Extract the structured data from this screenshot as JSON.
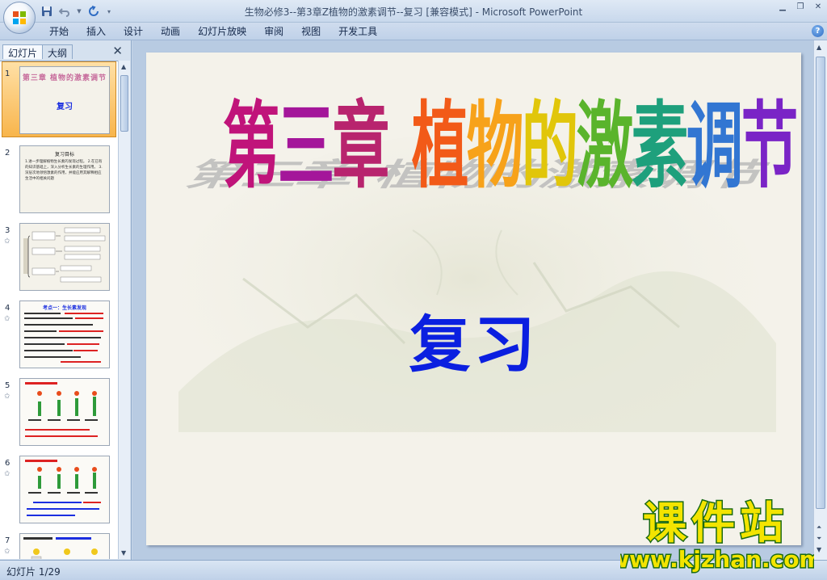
{
  "app": {
    "window_title": "生物必修3--第3章Z植物的激素调节--复习 [兼容模式] - Microsoft PowerPoint"
  },
  "ribbon": {
    "tabs": [
      "开始",
      "插入",
      "设计",
      "动画",
      "幻灯片放映",
      "审阅",
      "视图",
      "开发工具"
    ]
  },
  "pane": {
    "tab_slides": "幻灯片",
    "tab_outline": "大纲",
    "thumbnails": [
      {
        "num": "1",
        "anim": "",
        "title": "第三章 植物的激素调节",
        "body": "复习"
      },
      {
        "num": "2",
        "anim": "",
        "title": "复习目标",
        "body": "1.进一步理解植物生长素的发现过程。 2.在已有的知识基础上，深入分析生长素的生理作用。 3.深层次地领悟激素的作用，并能应用其解释相应生活中的相关问题"
      },
      {
        "num": "3",
        "anim": "✩",
        "title": "",
        "body": ""
      },
      {
        "num": "4",
        "anim": "✩",
        "title": "考点一：生长素发现",
        "body": ""
      },
      {
        "num": "5",
        "anim": "✩",
        "title": "",
        "body": ""
      },
      {
        "num": "6",
        "anim": "✩",
        "title": "",
        "body": ""
      },
      {
        "num": "7",
        "anim": "✩",
        "title": "",
        "body": ""
      }
    ]
  },
  "slide": {
    "title": "第三章 植物的激素调节",
    "title_chars": [
      "第",
      "三",
      "章",
      "植",
      "物",
      "的",
      "激",
      "素",
      "调",
      "节"
    ],
    "title_colors": [
      "#c0147a",
      "#a4169a",
      "#b8246e",
      "#f25a18",
      "#f7a21a",
      "#e1c60a",
      "#5ab42c",
      "#1ea07c",
      "#3276d2",
      "#7a24c6"
    ],
    "subtitle": "复习"
  },
  "status": {
    "slide_counter": "幻灯片 1/29"
  },
  "watermark": {
    "line1": "课件站",
    "line2": "www.kjzhan.com"
  }
}
